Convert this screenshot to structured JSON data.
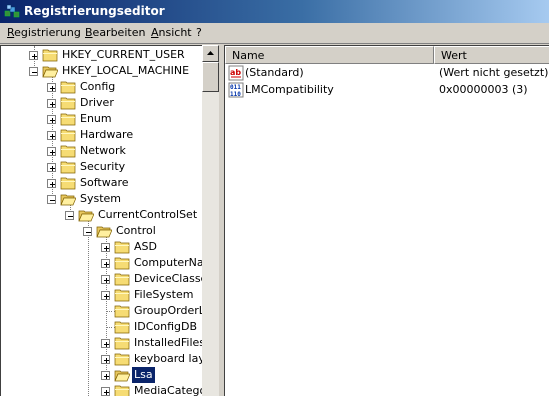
{
  "window": {
    "title": "Registrierungseditor"
  },
  "menu": [
    {
      "label": "Registrierung"
    },
    {
      "label": "Bearbeiten"
    },
    {
      "label": "Ansicht"
    },
    {
      "label": "?"
    }
  ],
  "tree": [
    {
      "label": "HKEY_CURRENT_USER",
      "expanded": false
    },
    {
      "label": "HKEY_LOCAL_MACHINE",
      "expanded": true
    },
    {
      "label": "Config",
      "expanded": false
    },
    {
      "label": "Driver",
      "expanded": false
    },
    {
      "label": "Enum",
      "expanded": false
    },
    {
      "label": "Hardware",
      "expanded": false
    },
    {
      "label": "Network",
      "expanded": false
    },
    {
      "label": "Security",
      "expanded": false
    },
    {
      "label": "Software",
      "expanded": false
    },
    {
      "label": "System",
      "expanded": true
    },
    {
      "label": "CurrentControlSet",
      "expanded": true
    },
    {
      "label": "Control",
      "expanded": true
    },
    {
      "label": "ASD",
      "expanded": false
    },
    {
      "label": "ComputerNar",
      "expanded": false
    },
    {
      "label": "DeviceClasse",
      "expanded": false
    },
    {
      "label": "FileSystem",
      "expanded": false
    },
    {
      "label": "GroupOrderL",
      "expanded": null
    },
    {
      "label": "IDConfigDB",
      "expanded": null
    },
    {
      "label": "InstalledFiles",
      "expanded": false
    },
    {
      "label": "keyboard lay",
      "expanded": false
    },
    {
      "label": "Lsa",
      "expanded": false,
      "selected": true
    },
    {
      "label": "MediaCatego",
      "expanded": false
    }
  ],
  "list": {
    "columns": {
      "name": "Name",
      "value": "Wert"
    },
    "rows": [
      {
        "icon": "string-value-icon",
        "name": "(Standard)",
        "value": "(Wert nicht gesetzt)"
      },
      {
        "icon": "binary-value-icon",
        "name": "LMCompatibility",
        "value": "0x00000003 (3)"
      }
    ]
  }
}
